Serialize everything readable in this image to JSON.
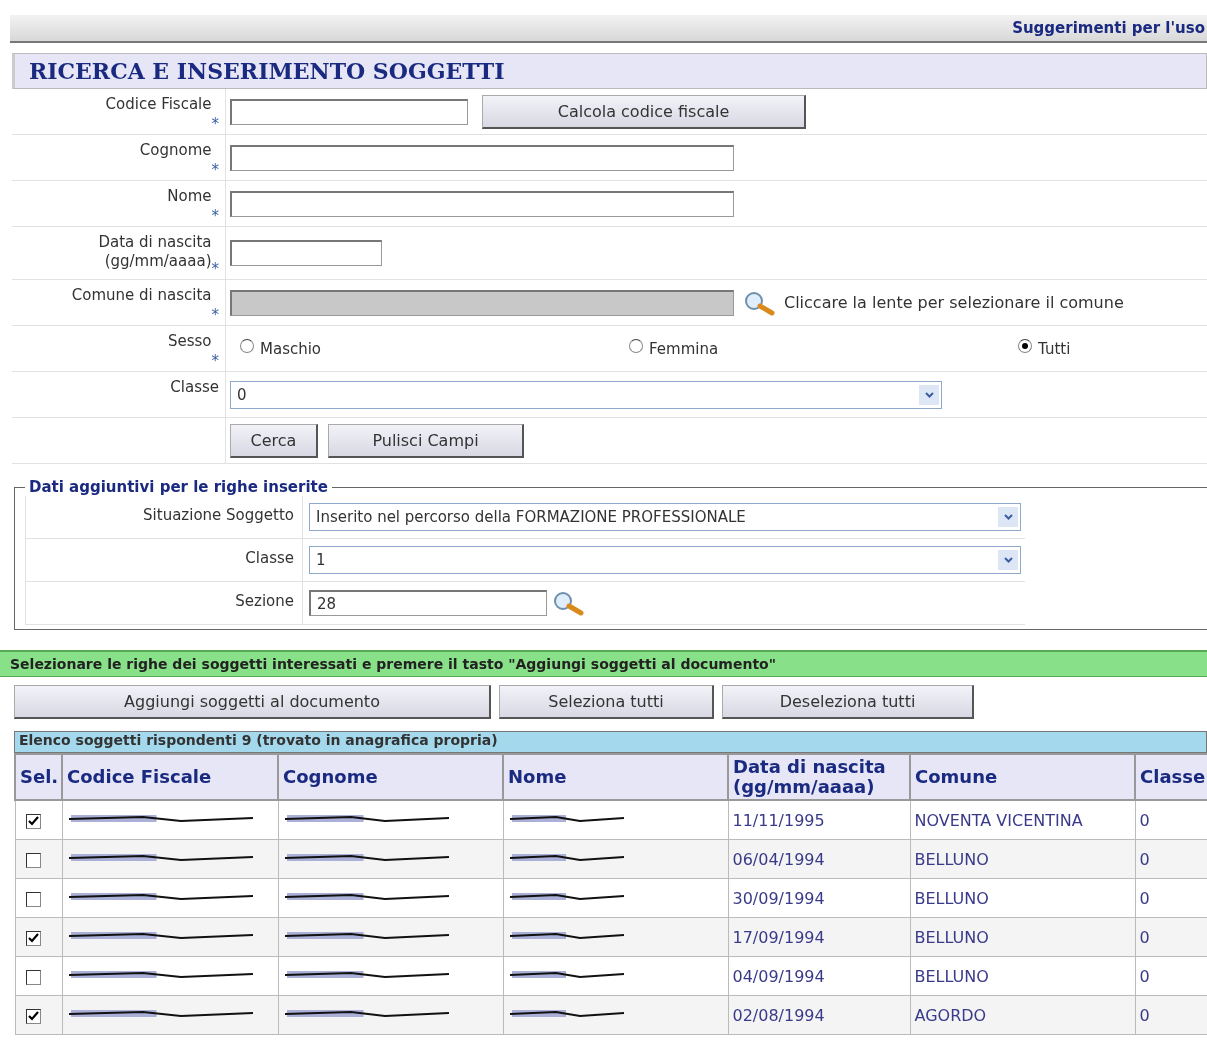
{
  "top_link": "Suggerimenti per l'uso",
  "title": "RICERCA E INSERIMENTO SOGGETTI",
  "form": [
    {
      "kind": "text_button",
      "label": "Codice Fiscale",
      "required_mark": "*",
      "button": "Calcola codice fiscale"
    },
    {
      "kind": "text",
      "label": "Cognome",
      "required_mark": "*"
    },
    {
      "kind": "text",
      "label": "Nome",
      "required_mark": "*"
    },
    {
      "kind": "date",
      "label": "Data di nascita (gg/mm/aaaa)",
      "required_mark": "*"
    },
    {
      "kind": "lookup",
      "label": "Comune di nascita",
      "required_mark": "*",
      "hint": "Cliccare la lente per selezionare il comune"
    },
    {
      "kind": "radio",
      "label": "Sesso",
      "required_mark": "*",
      "options": [
        {
          "label": "Maschio",
          "selected": false
        },
        {
          "label": "Femmina",
          "selected": false
        },
        {
          "label": "Tutti",
          "selected": true
        }
      ]
    },
    {
      "kind": "select",
      "label": "Classe",
      "value": "0"
    },
    {
      "kind": "buttons",
      "buttons": [
        "Cerca",
        "Pulisci Campi"
      ]
    }
  ],
  "extra": {
    "legend": "Dati aggiuntivi per le righe inserite",
    "rows": [
      {
        "kind": "select",
        "label": "Situazione Soggetto",
        "value": "Inserito nel percorso della FORMAZIONE PROFESSIONALE"
      },
      {
        "kind": "select",
        "label": "Classe",
        "value": "1"
      },
      {
        "kind": "lookup",
        "label": "Sezione",
        "value": "28"
      }
    ]
  },
  "instruction": "Selezionare le righe dei soggetti interessati e premere il tasto \"Aggiungi soggetti al documento\"",
  "actions": [
    "Aggiungi soggetti al documento",
    "Seleziona tutti",
    "Deseleziona tutti"
  ],
  "results": {
    "caption": "Elenco soggetti rispondenti 9 (trovato in anagrafica propria)",
    "columns": [
      "Sel.",
      "Codice Fiscale",
      "Cognome",
      "Nome",
      "Data di nascita (gg/mm/aaaa)",
      "Comune",
      "Classe"
    ],
    "rows": [
      {
        "checked": true,
        "date": "11/11/1995",
        "comune": "NOVENTA VICENTINA",
        "classe": "0"
      },
      {
        "checked": false,
        "date": "06/04/1994",
        "comune": "BELLUNO",
        "classe": "0"
      },
      {
        "checked": false,
        "date": "30/09/1994",
        "comune": "BELLUNO",
        "classe": "0"
      },
      {
        "checked": true,
        "date": "17/09/1994",
        "comune": "BELLUNO",
        "classe": "0"
      },
      {
        "checked": false,
        "date": "04/09/1994",
        "comune": "BELLUNO",
        "classe": "0"
      },
      {
        "checked": true,
        "date": "02/08/1994",
        "comune": "AGORDO",
        "classe": "0"
      }
    ]
  }
}
